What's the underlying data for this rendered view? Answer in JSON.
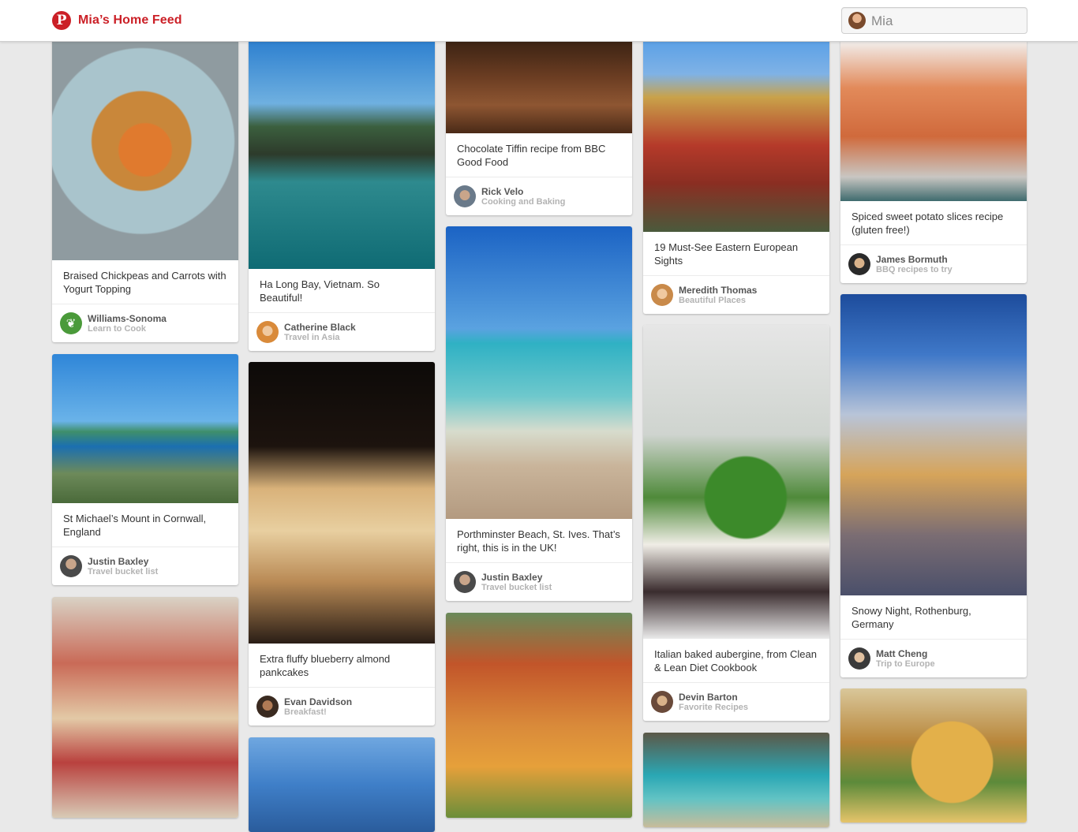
{
  "header": {
    "logo_glyph": "P",
    "title": "Mia’s Home Feed",
    "user_name": "Mia"
  },
  "pins": [
    {
      "desc": "Braised Chickpeas and Carrots with Yogurt Topping",
      "user": "Williams-Sonoma",
      "board": "Learn to Cook"
    },
    {
      "desc": "St Michael’s Mount in Cornwall, England",
      "user": "Justin Baxley",
      "board": "Travel bucket list"
    },
    {
      "desc": "Ha Long Bay, Vietnam. So Beautiful!",
      "user": "Catherine Black",
      "board": "Travel in Asia"
    },
    {
      "desc": "Extra fluffy blueberry almond pankcakes",
      "user": "Evan Davidson",
      "board": "Breakfast!"
    },
    {
      "desc": "Chocolate Tiffin recipe from BBC Good Food",
      "user": "Rick Velo",
      "board": "Cooking and Baking"
    },
    {
      "desc": "Porthminster Beach, St. Ives. That’s right, this is in the UK!",
      "user": "Justin Baxley",
      "board": "Travel bucket list"
    },
    {
      "desc": "19 Must-See Eastern European Sights",
      "user": "Meredith Thomas",
      "board": "Beautiful Places"
    },
    {
      "desc": "Italian baked aubergine, from Clean & Lean Diet Cookbook",
      "user": "Devin Barton",
      "board": "Favorite Recipes"
    },
    {
      "desc": "Spiced sweet potato slices recipe (gluten free!)",
      "user": "James Bormuth",
      "board": "BBQ recipes to try"
    },
    {
      "desc": "Snowy Night, Rothenburg, Germany",
      "user": "Matt Cheng",
      "board": "Trip to Europe"
    }
  ]
}
